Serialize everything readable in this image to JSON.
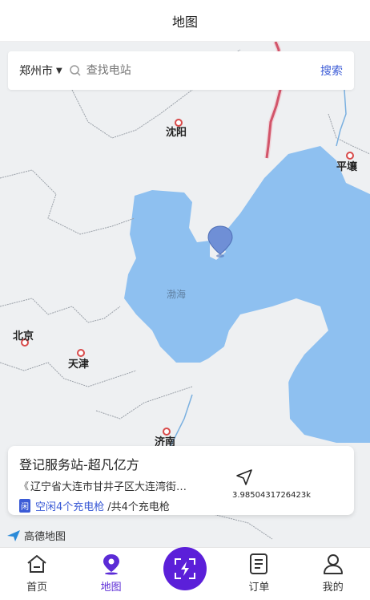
{
  "header": {
    "title": "地图"
  },
  "search": {
    "city": "郑州市",
    "placeholder": "查找电站",
    "button_label": "搜索"
  },
  "map": {
    "labels": {
      "shenyang": "沈阳",
      "pyongyang": "平壤",
      "bohai": "渤海",
      "beijing": "北京",
      "tianjin": "天津",
      "jinan": "济南"
    },
    "provider": "高德地图",
    "colors": {
      "water": "#8ec0f0",
      "land": "#eef0f2",
      "border": "#c22d45",
      "river": "#7ab0e0",
      "marker": "#6f8fd6"
    }
  },
  "station": {
    "name": "登记服务站-超凡亿方",
    "address": "辽宁省大连市甘井子区大连湾街…",
    "idle_badge": "闲",
    "idle_text": "空闲4个充电枪",
    "total_text": "/共4个充电枪",
    "distance": "3.9850431726423k"
  },
  "tabbar": {
    "items": [
      {
        "label": "首页",
        "icon": "home-icon"
      },
      {
        "label": "地图",
        "icon": "map-pin-icon",
        "active": true
      },
      {
        "label": "",
        "icon": "scan-charge-icon"
      },
      {
        "label": "订单",
        "icon": "order-list-icon"
      },
      {
        "label": "我的",
        "icon": "user-icon"
      }
    ]
  }
}
